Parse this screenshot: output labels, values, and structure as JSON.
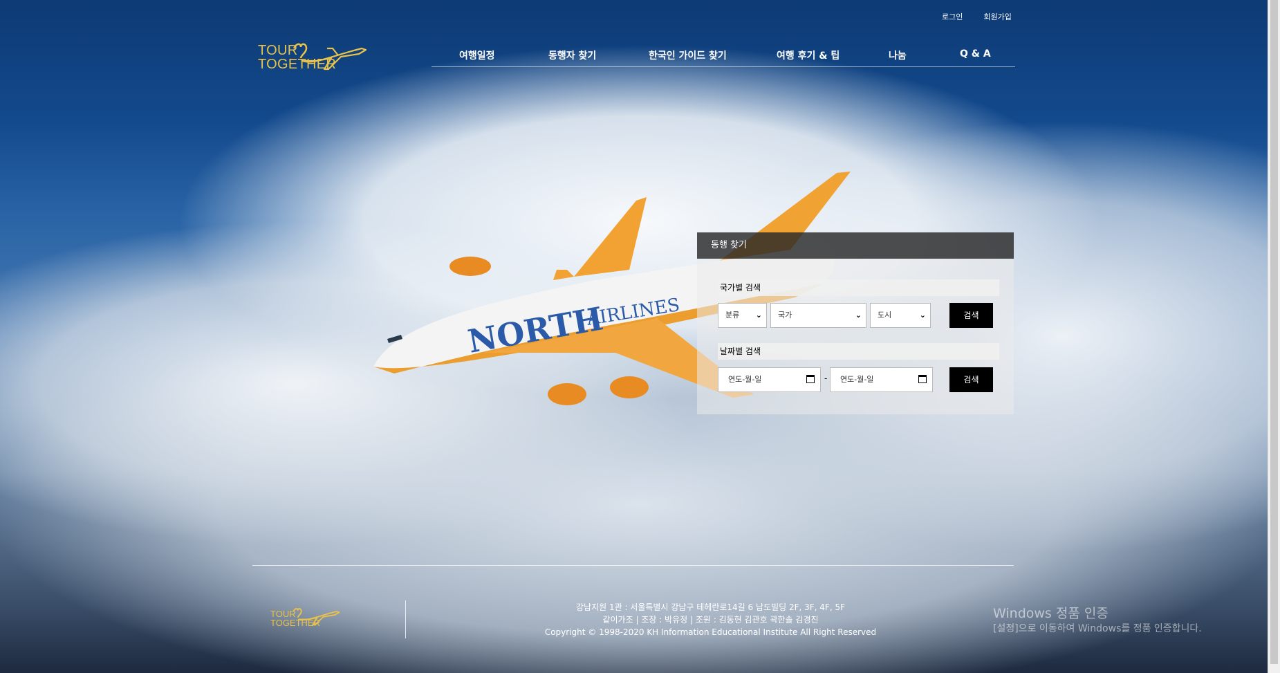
{
  "toplinks": {
    "login": "로그인",
    "signup": "회원가입"
  },
  "logo": {
    "line1": "TOUR",
    "line2": "TOGETHER"
  },
  "nav": {
    "items": [
      "여행일정",
      "동행자 찾기",
      "한국인 가이드 찾기",
      "여행 후기 & 팁",
      "나눔",
      "Q & A"
    ]
  },
  "plane": {
    "text1": "NORTH",
    "text2": "AIRLINES"
  },
  "search": {
    "title": "동행 찾기",
    "country_section_label": "국가별 검색",
    "category_value": "분류",
    "country_value": "국가",
    "city_value": "도시",
    "search_button": "검색",
    "date_section_label": "날짜별 검색",
    "date_from_value": "연도-월-일",
    "date_separator": "-",
    "date_to_value": "연도-월-일",
    "date_search_button": "검색"
  },
  "footer": {
    "line1": "강남지원 1관 : 서울특별시 강남구 테헤란로14길 6 남도빌딩 2F, 3F, 4F, 5F",
    "line2": "같이가조 | 조장 : 박유정 | 조원 : 김동현 김관호 곽한솔 김경진",
    "line3": "Copyright © 1998-2020 KH Information Educational Institute All Right Reserved"
  },
  "watermark": {
    "line1": "Windows 정품 인증",
    "line2": "[설정]으로 이동하여 Windows를 정품 인증합니다."
  },
  "colors": {
    "logo": "#e8c24a",
    "button": "#000000",
    "panel_header": "#282828"
  }
}
